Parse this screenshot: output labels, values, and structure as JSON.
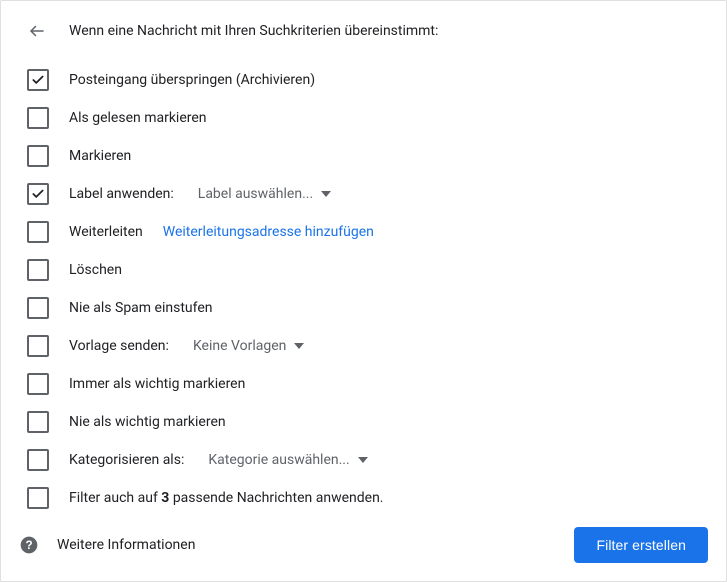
{
  "header": {
    "title": "Wenn eine Nachricht mit Ihren Suchkriterien übereinstimmt:"
  },
  "options": {
    "skip_inbox": {
      "label": "Posteingang überspringen (Archivieren)",
      "checked": true
    },
    "mark_read": {
      "label": "Als gelesen markieren",
      "checked": false
    },
    "star": {
      "label": "Markieren",
      "checked": false
    },
    "apply_label": {
      "label": "Label anwenden:",
      "checked": true,
      "focused": true,
      "select_value": "Label auswählen..."
    },
    "forward": {
      "label": "Weiterleiten",
      "checked": false,
      "link_text": "Weiterleitungsadresse hinzufügen"
    },
    "delete": {
      "label": "Löschen",
      "checked": false
    },
    "never_spam": {
      "label": "Nie als Spam einstufen",
      "checked": false
    },
    "send_template": {
      "label": "Vorlage senden:",
      "checked": false,
      "select_value": "Keine Vorlagen"
    },
    "always_important": {
      "label": "Immer als wichtig markieren",
      "checked": false
    },
    "never_important": {
      "label": "Nie als wichtig markieren",
      "checked": false
    },
    "categorize": {
      "label": "Kategorisieren als:",
      "checked": false,
      "select_value": "Kategorie auswählen..."
    },
    "apply_existing": {
      "prefix": "Filter auch auf ",
      "count": "3",
      "suffix": " passende Nachrichten anwenden.",
      "checked": false
    }
  },
  "footer": {
    "info_label": "Weitere Informationen",
    "primary_label": "Filter erstellen"
  },
  "colors": {
    "link": "#1a73e8",
    "text": "#202124",
    "muted": "#5f6368"
  }
}
